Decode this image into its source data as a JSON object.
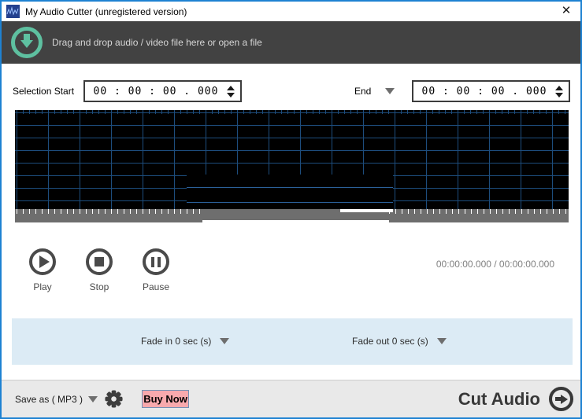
{
  "window": {
    "title": "My Audio Cutter (unregistered version)",
    "close_glyph": "✕"
  },
  "dropzone": {
    "text": "Drag and drop audio / video file here or open a file"
  },
  "selection": {
    "start_label": "Selection Start",
    "start_value": "00 : 00 : 00 . 000",
    "end_label": "End",
    "end_value": "00 : 00 : 00 . 000"
  },
  "transport": {
    "play": "Play",
    "stop": "Stop",
    "pause": "Pause"
  },
  "time_display": "00:00:00.000 / 00:00:00.000",
  "fade": {
    "fade_in": "Fade in 0 sec (s)",
    "fade_out": "Fade out 0 sec (s)"
  },
  "footer": {
    "save_as": "Save as ( MP3 )",
    "buy_now": "Buy Now",
    "cut_audio": "Cut Audio"
  },
  "icons": {
    "app_icon": "waveform-logo",
    "download_icon": "circle-down-arrow",
    "close_icon": "x",
    "spinner_icons": "up-down-triangles",
    "dropdown_icon": "triangle-down",
    "play_icon": "circle-play",
    "stop_icon": "circle-stop",
    "pause_icon": "circle-pause",
    "gear_icon": "gear",
    "cut_audio_icon": "circle-right-arrow"
  },
  "colors": {
    "window_border": "#1e82d2",
    "dropzone_bg": "#424242",
    "accent_teal": "#5ec0a0",
    "grid_blue": "#1d4d7d",
    "waveform_line": "#2b6099",
    "scrub_gray": "#6e6e6e",
    "fade_panel_bg": "#dcebf5",
    "footer_bg": "#e9e9e9",
    "buy_now_bg": "#f8a9ad",
    "buy_now_border": "#7291b5"
  }
}
